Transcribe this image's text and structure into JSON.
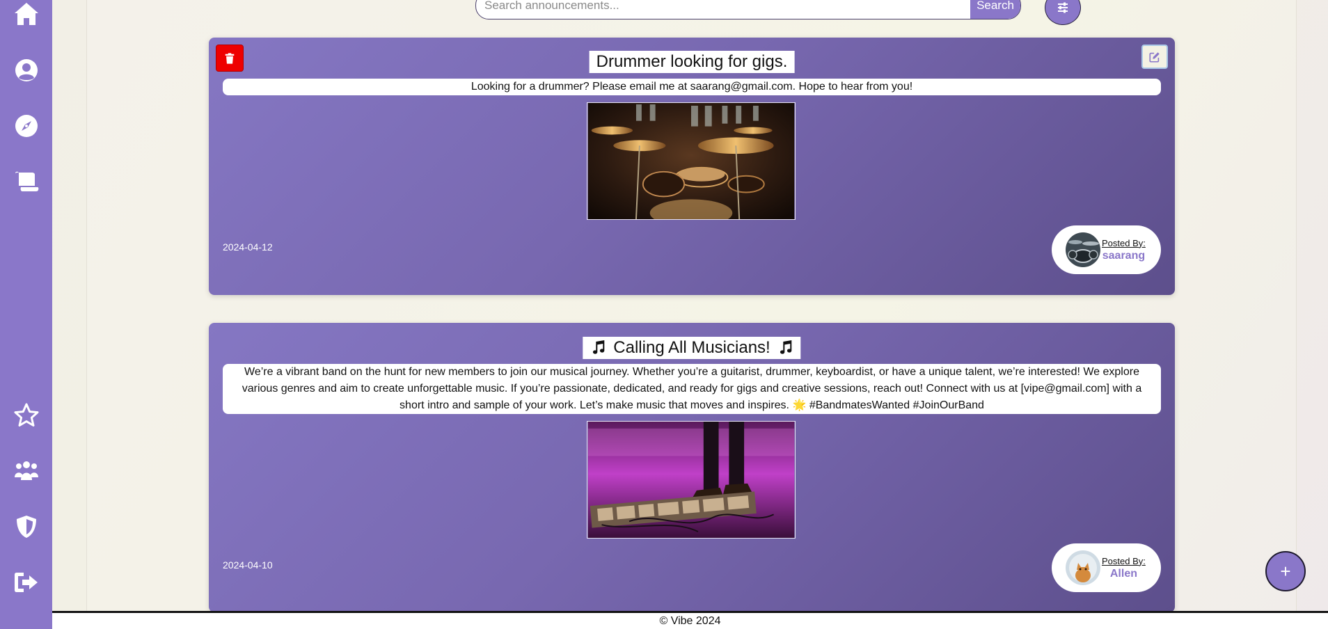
{
  "sidebar": {
    "top_items": [
      {
        "name": "home",
        "icon": "home-icon"
      },
      {
        "name": "profile",
        "icon": "user-circle-icon"
      },
      {
        "name": "explore",
        "icon": "compass-icon"
      },
      {
        "name": "announcements",
        "icon": "scroll-icon"
      }
    ],
    "bottom_items": [
      {
        "name": "favorites",
        "icon": "star-icon"
      },
      {
        "name": "groups",
        "icon": "people-group-icon"
      },
      {
        "name": "security",
        "icon": "shield-icon"
      },
      {
        "name": "logout",
        "icon": "sign-out-icon"
      }
    ]
  },
  "search": {
    "placeholder": "Search announcements...",
    "button_label": "Search",
    "filter_icon": "sliders-icon"
  },
  "announcements": [
    {
      "title": "Drummer looking for gigs.",
      "description": "Looking for a drummer? Please email me at saarang@gmail.com. Hope to hear from you!",
      "image": "drum-kit-photo",
      "date": "2024-04-12",
      "posted_by_label": "Posted By:",
      "author": "saarang",
      "can_delete": true,
      "can_edit": true
    },
    {
      "title": "Calling All Musicians!",
      "title_icon": "music-notes-icon",
      "description": "We’re a vibrant band on the hunt for new members to join our musical journey. Whether you’re a guitarist, drummer, keyboardist, or have a unique talent, we’re interested! We explore various genres and aim to create unforgettable music. If you’re passionate, dedicated, and ready for gigs and creative sessions, reach out! Connect with us at [vipe@gmail.com] with a short intro and sample of your work. Let’s make music that moves and inspires. 🌟 #BandmatesWanted #JoinOurBand",
      "image": "guitar-pedalboard-stage-photo",
      "date": "2024-04-10",
      "posted_by_label": "Posted By:",
      "author": "Allen"
    }
  ],
  "fab": {
    "label": "+"
  },
  "footer": {
    "text": "© Vibe 2024"
  },
  "colors": {
    "sidebar": "#8a77c9",
    "accent": "#8a77c9",
    "delete": "#ee0000",
    "card_start": "#8577c3",
    "card_end": "#5d4f8c"
  }
}
